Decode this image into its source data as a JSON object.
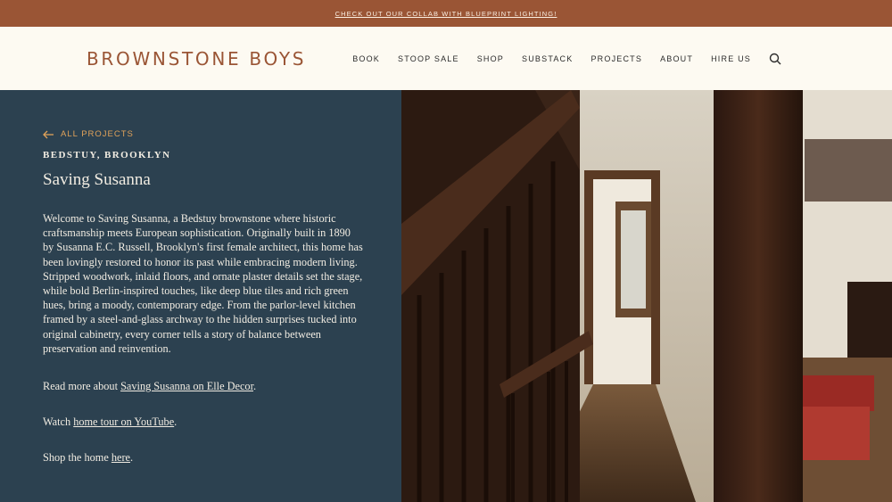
{
  "banner": {
    "text": "CHECK OUT OUR COLLAB WITH BLUEPRINT LIGHTING!"
  },
  "header": {
    "logo": "BROWNSTONE BOYS",
    "nav": [
      "BOOK",
      "STOOP SALE",
      "SHOP",
      "SUBSTACK",
      "PROJECTS",
      "ABOUT",
      "HIRE US"
    ],
    "search_icon": "search-icon"
  },
  "project": {
    "back_label": "ALL PROJECTS",
    "location": "BEDSTUY, BROOKLYN",
    "title": "Saving Susanna",
    "description": "Welcome to Saving Susanna, a Bedstuy brownstone where historic craftsmanship meets European sophistication. Originally built in 1890 by Susanna E.C. Russell, Brooklyn's first female architect, this home has been lovingly restored to honor its past while embracing modern living. Stripped woodwork, inlaid floors, and ornate plaster details set the stage, while bold Berlin-inspired touches, like deep blue tiles and rich green hues, bring a moody, contemporary edge. From the parlor-level kitchen framed by a steel-and-glass archway to the hidden surprises tucked into original cabinetry, every corner tells a story of balance between preservation and reinvention.",
    "read_more": {
      "prefix": "Read more about ",
      "link": "Saving Susanna on Elle Decor",
      "suffix": "."
    },
    "watch": {
      "prefix": "Watch ",
      "link": "home tour on YouTube",
      "suffix": "."
    },
    "shop": {
      "prefix": "Shop the home ",
      "link": "here",
      "suffix": "."
    }
  },
  "colors": {
    "banner": "#9a5535",
    "accent": "#e0a25a",
    "panel": "#2c4150",
    "header_bg": "#fdfaf2"
  }
}
